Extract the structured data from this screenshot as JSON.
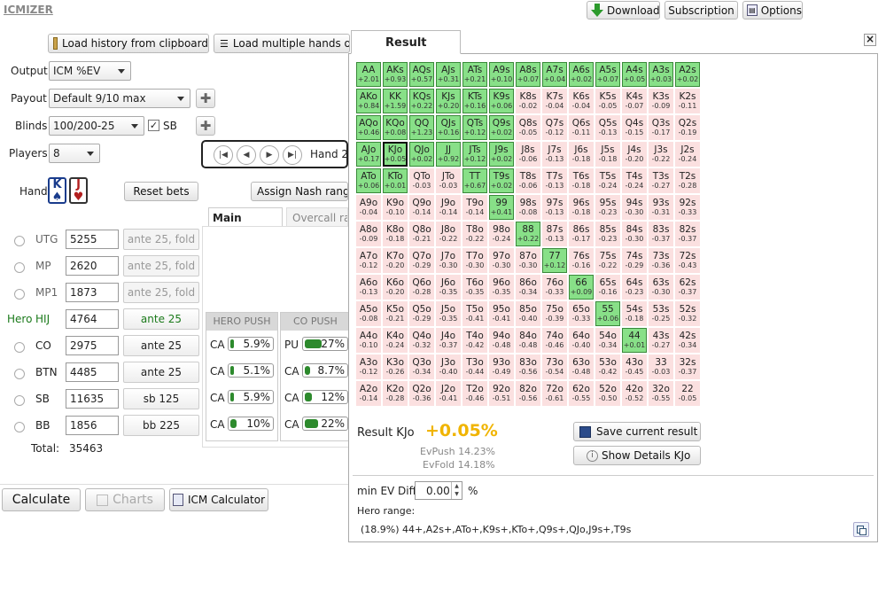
{
  "app": {
    "logo": "ICMIZER"
  },
  "topbar": {
    "download": "Download",
    "subscription": "Subscription",
    "options": "Options"
  },
  "toolbar": {
    "load_history": "Load history from clipboard",
    "load_multiple": "Load multiple hands o"
  },
  "form": {
    "output_label": "Output",
    "output_value": "ICM %EV",
    "payout_label": "Payout",
    "payout_value": "Default 9/10 max",
    "blinds_label": "Blinds",
    "blinds_value": "100/200-25",
    "sb_label": "SB",
    "players_label": "Players",
    "players_value": "8",
    "hand_label": "Hand",
    "hand_nav_text": "Hand 2"
  },
  "hand_cards": [
    {
      "rank": "K",
      "suit": "♠"
    },
    {
      "rank": "J",
      "suit": "♥"
    }
  ],
  "buttons": {
    "reset_bets": "Reset bets",
    "assign_nash": "Assign Nash range",
    "calculate": "Calculate",
    "charts": "Charts",
    "icm_calc": "ICM Calculator"
  },
  "tabs": {
    "main": "Main ranges",
    "overcall": "Overcall ra"
  },
  "players": [
    {
      "pos": "UTG",
      "stack": "5255",
      "action": "ante 25, fold",
      "hero": false,
      "active": false
    },
    {
      "pos": "MP",
      "stack": "2620",
      "action": "ante 25, fold",
      "hero": false,
      "active": false
    },
    {
      "pos": "MP1",
      "stack": "1873",
      "action": "ante 25, fold",
      "hero": false,
      "active": false
    },
    {
      "pos": "HIJ",
      "stack": "4764",
      "action": "ante 25",
      "hero": true,
      "active": true,
      "hero_label": "Hero"
    },
    {
      "pos": "CO",
      "stack": "2975",
      "action": "ante 25",
      "hero": false,
      "active": true
    },
    {
      "pos": "BTN",
      "stack": "4485",
      "action": "ante 25",
      "hero": false,
      "active": true
    },
    {
      "pos": "SB",
      "stack": "11635",
      "action": "sb 125",
      "hero": false,
      "active": true
    },
    {
      "pos": "BB",
      "stack": "1856",
      "action": "bb 225",
      "hero": false,
      "active": true
    }
  ],
  "total": {
    "label": "Total:",
    "value": "35463"
  },
  "push_tables": {
    "hero": {
      "title": "HERO PUSH",
      "rows": [
        {
          "label": "CA",
          "pct": "5.9%",
          "fill": 5.9
        },
        {
          "label": "CA",
          "pct": "5.1%",
          "fill": 5.1
        },
        {
          "label": "CA",
          "pct": "5.9%",
          "fill": 5.9
        },
        {
          "label": "CA",
          "pct": "10%",
          "fill": 10
        }
      ]
    },
    "co": {
      "title": "CO PUSH",
      "rows": [
        {
          "label": "PU",
          "pct": "27%",
          "fill": 27
        },
        {
          "label": "CA",
          "pct": "8.7%",
          "fill": 8.7
        },
        {
          "label": "CA",
          "pct": "12%",
          "fill": 12
        },
        {
          "label": "CA",
          "pct": "22%",
          "fill": 22
        }
      ]
    }
  },
  "result": {
    "title": "Result",
    "close": "×",
    "summary_label": "Result KJo",
    "summary_value": "+0.05%",
    "ev_push": "EvPush 14.23%",
    "ev_fold": "EvFold 14.18%",
    "save_btn": "Save current result",
    "details_btn": "Show Details KJo",
    "min_ev_label": "min EV Diff",
    "min_ev_value": "0.00",
    "min_ev_unit": "%",
    "hero_range_label": "Hero range:",
    "hero_range": "(18.9%) 44+,A2s+,ATo+,K9s+,KTo+,Q9s+,QJo,J9s+,T9s",
    "selected_hand": "KJo",
    "matrix": [
      [
        [
          "AA",
          "+2.01",
          1
        ],
        [
          "AKs",
          "+0.93",
          1
        ],
        [
          "AQs",
          "+0.57",
          1
        ],
        [
          "AJs",
          "+0.31",
          1
        ],
        [
          "ATs",
          "+0.21",
          1
        ],
        [
          "A9s",
          "+0.10",
          1
        ],
        [
          "A8s",
          "+0.07",
          1
        ],
        [
          "A7s",
          "+0.04",
          1
        ],
        [
          "A6s",
          "+0.02",
          1
        ],
        [
          "A5s",
          "+0.07",
          1
        ],
        [
          "A4s",
          "+0.05",
          1
        ],
        [
          "A3s",
          "+0.03",
          1
        ],
        [
          "A2s",
          "+0.02",
          1
        ]
      ],
      [
        [
          "AKo",
          "+0.84",
          1
        ],
        [
          "KK",
          "+1.59",
          1
        ],
        [
          "KQs",
          "+0.22",
          1
        ],
        [
          "KJs",
          "+0.20",
          1
        ],
        [
          "KTs",
          "+0.16",
          1
        ],
        [
          "K9s",
          "+0.06",
          1
        ],
        [
          "K8s",
          "-0.02",
          0
        ],
        [
          "K7s",
          "-0.04",
          0
        ],
        [
          "K6s",
          "-0.04",
          0
        ],
        [
          "K5s",
          "-0.05",
          0
        ],
        [
          "K4s",
          "-0.07",
          0
        ],
        [
          "K3s",
          "-0.09",
          0
        ],
        [
          "K2s",
          "-0.11",
          0
        ]
      ],
      [
        [
          "AQo",
          "+0.46",
          1
        ],
        [
          "KQo",
          "+0.08",
          1
        ],
        [
          "QQ",
          "+1.23",
          1
        ],
        [
          "QJs",
          "+0.16",
          1
        ],
        [
          "QTs",
          "+0.12",
          1
        ],
        [
          "Q9s",
          "+0.02",
          1
        ],
        [
          "Q8s",
          "-0.05",
          0
        ],
        [
          "Q7s",
          "-0.12",
          0
        ],
        [
          "Q6s",
          "-0.11",
          0
        ],
        [
          "Q5s",
          "-0.13",
          0
        ],
        [
          "Q4s",
          "-0.15",
          0
        ],
        [
          "Q3s",
          "-0.17",
          0
        ],
        [
          "Q2s",
          "-0.19",
          0
        ]
      ],
      [
        [
          "AJo",
          "+0.17",
          1
        ],
        [
          "KJo",
          "+0.05",
          1
        ],
        [
          "QJo",
          "+0.02",
          1
        ],
        [
          "JJ",
          "+0.92",
          1
        ],
        [
          "JTs",
          "+0.12",
          1
        ],
        [
          "J9s",
          "+0.02",
          1
        ],
        [
          "J8s",
          "-0.06",
          0
        ],
        [
          "J7s",
          "-0.13",
          0
        ],
        [
          "J6s",
          "-0.18",
          0
        ],
        [
          "J5s",
          "-0.18",
          0
        ],
        [
          "J4s",
          "-0.20",
          0
        ],
        [
          "J3s",
          "-0.22",
          0
        ],
        [
          "J2s",
          "-0.24",
          0
        ]
      ],
      [
        [
          "ATo",
          "+0.06",
          1
        ],
        [
          "KTo",
          "+0.01",
          1
        ],
        [
          "QTo",
          "-0.03",
          0
        ],
        [
          "JTo",
          "-0.03",
          0
        ],
        [
          "TT",
          "+0.67",
          1
        ],
        [
          "T9s",
          "+0.02",
          1
        ],
        [
          "T8s",
          "-0.06",
          0
        ],
        [
          "T7s",
          "-0.13",
          0
        ],
        [
          "T6s",
          "-0.18",
          0
        ],
        [
          "T5s",
          "-0.24",
          0
        ],
        [
          "T4s",
          "-0.24",
          0
        ],
        [
          "T3s",
          "-0.27",
          0
        ],
        [
          "T2s",
          "-0.28",
          0
        ]
      ],
      [
        [
          "A9o",
          "-0.04",
          0
        ],
        [
          "K9o",
          "-0.10",
          0
        ],
        [
          "Q9o",
          "-0.14",
          0
        ],
        [
          "J9o",
          "-0.14",
          0
        ],
        [
          "T9o",
          "-0.14",
          0
        ],
        [
          "99",
          "+0.41",
          1
        ],
        [
          "98s",
          "-0.08",
          0
        ],
        [
          "97s",
          "-0.13",
          0
        ],
        [
          "96s",
          "-0.18",
          0
        ],
        [
          "95s",
          "-0.23",
          0
        ],
        [
          "94s",
          "-0.30",
          0
        ],
        [
          "93s",
          "-0.31",
          0
        ],
        [
          "92s",
          "-0.33",
          0
        ]
      ],
      [
        [
          "A8o",
          "-0.09",
          0
        ],
        [
          "K8o",
          "-0.18",
          0
        ],
        [
          "Q8o",
          "-0.21",
          0
        ],
        [
          "J8o",
          "-0.22",
          0
        ],
        [
          "T8o",
          "-0.22",
          0
        ],
        [
          "98o",
          "-0.24",
          0
        ],
        [
          "88",
          "+0.22",
          1
        ],
        [
          "87s",
          "-0.13",
          0
        ],
        [
          "86s",
          "-0.17",
          0
        ],
        [
          "85s",
          "-0.23",
          0
        ],
        [
          "84s",
          "-0.30",
          0
        ],
        [
          "83s",
          "-0.37",
          0
        ],
        [
          "82s",
          "-0.37",
          0
        ]
      ],
      [
        [
          "A7o",
          "-0.12",
          0
        ],
        [
          "K7o",
          "-0.20",
          0
        ],
        [
          "Q7o",
          "-0.29",
          0
        ],
        [
          "J7o",
          "-0.30",
          0
        ],
        [
          "T7o",
          "-0.30",
          0
        ],
        [
          "97o",
          "-0.30",
          0
        ],
        [
          "87o",
          "-0.30",
          0
        ],
        [
          "77",
          "+0.12",
          1
        ],
        [
          "76s",
          "-0.16",
          0
        ],
        [
          "75s",
          "-0.22",
          0
        ],
        [
          "74s",
          "-0.29",
          0
        ],
        [
          "73s",
          "-0.36",
          0
        ],
        [
          "72s",
          "-0.43",
          0
        ]
      ],
      [
        [
          "A6o",
          "-0.13",
          0
        ],
        [
          "K6o",
          "-0.20",
          0
        ],
        [
          "Q6o",
          "-0.28",
          0
        ],
        [
          "J6o",
          "-0.35",
          0
        ],
        [
          "T6o",
          "-0.35",
          0
        ],
        [
          "96o",
          "-0.35",
          0
        ],
        [
          "86o",
          "-0.34",
          0
        ],
        [
          "76o",
          "-0.33",
          0
        ],
        [
          "66",
          "+0.09",
          1
        ],
        [
          "65s",
          "-0.16",
          0
        ],
        [
          "64s",
          "-0.23",
          0
        ],
        [
          "63s",
          "-0.30",
          0
        ],
        [
          "62s",
          "-0.37",
          0
        ]
      ],
      [
        [
          "A5o",
          "-0.08",
          0
        ],
        [
          "K5o",
          "-0.21",
          0
        ],
        [
          "Q5o",
          "-0.29",
          0
        ],
        [
          "J5o",
          "-0.35",
          0
        ],
        [
          "T5o",
          "-0.41",
          0
        ],
        [
          "95o",
          "-0.41",
          0
        ],
        [
          "85o",
          "-0.40",
          0
        ],
        [
          "75o",
          "-0.39",
          0
        ],
        [
          "65o",
          "-0.33",
          0
        ],
        [
          "55",
          "+0.06",
          1
        ],
        [
          "54s",
          "-0.18",
          0
        ],
        [
          "53s",
          "-0.25",
          0
        ],
        [
          "52s",
          "-0.32",
          0
        ]
      ],
      [
        [
          "A4o",
          "-0.10",
          0
        ],
        [
          "K4o",
          "-0.24",
          0
        ],
        [
          "Q4o",
          "-0.32",
          0
        ],
        [
          "J4o",
          "-0.37",
          0
        ],
        [
          "T4o",
          "-0.42",
          0
        ],
        [
          "94o",
          "-0.48",
          0
        ],
        [
          "84o",
          "-0.48",
          0
        ],
        [
          "74o",
          "-0.46",
          0
        ],
        [
          "64o",
          "-0.40",
          0
        ],
        [
          "54o",
          "-0.34",
          0
        ],
        [
          "44",
          "+0.01",
          1
        ],
        [
          "43s",
          "-0.27",
          0
        ],
        [
          "42s",
          "-0.34",
          0
        ]
      ],
      [
        [
          "A3o",
          "-0.12",
          0
        ],
        [
          "K3o",
          "-0.26",
          0
        ],
        [
          "Q3o",
          "-0.34",
          0
        ],
        [
          "J3o",
          "-0.40",
          0
        ],
        [
          "T3o",
          "-0.44",
          0
        ],
        [
          "93o",
          "-0.49",
          0
        ],
        [
          "83o",
          "-0.56",
          0
        ],
        [
          "73o",
          "-0.54",
          0
        ],
        [
          "63o",
          "-0.48",
          0
        ],
        [
          "53o",
          "-0.42",
          0
        ],
        [
          "43o",
          "-0.45",
          0
        ],
        [
          "33",
          "-0.03",
          0
        ],
        [
          "32s",
          "-0.37",
          0
        ]
      ],
      [
        [
          "A2o",
          "-0.14",
          0
        ],
        [
          "K2o",
          "-0.28",
          0
        ],
        [
          "Q2o",
          "-0.36",
          0
        ],
        [
          "J2o",
          "-0.41",
          0
        ],
        [
          "T2o",
          "-0.46",
          0
        ],
        [
          "92o",
          "-0.51",
          0
        ],
        [
          "82o",
          "-0.56",
          0
        ],
        [
          "72o",
          "-0.61",
          0
        ],
        [
          "62o",
          "-0.55",
          0
        ],
        [
          "52o",
          "-0.50",
          0
        ],
        [
          "42o",
          "-0.52",
          0
        ],
        [
          "32o",
          "-0.55",
          0
        ],
        [
          "22",
          "-0.05",
          0
        ]
      ]
    ]
  },
  "colors": {
    "push_green": "#88e088",
    "fold_pink": "#fbe0e0",
    "result_value": "#f0b400"
  }
}
